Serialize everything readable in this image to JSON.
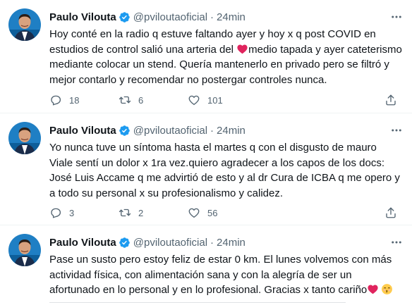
{
  "tweets": [
    {
      "name": "Paulo Vilouta",
      "handle": "@pviloutaoficial",
      "separator": "·",
      "time": "24min",
      "text_before_emoji": "Hoy conté en la radio q estuve faltando ayer y hoy x q post COVID en estudios de control salió una arteria del ",
      "emoji": "red-heart",
      "text_after_emoji": "medio tapada y ayer cateterismo mediante colocar un stend. Quería mantenerlo en privado pero se filtró y mejor contarlo y recomendar no postergar controles nunca.",
      "replies": "18",
      "retweets": "6",
      "likes": "101"
    },
    {
      "name": "Paulo Vilouta",
      "handle": "@pviloutaoficial",
      "separator": "·",
      "time": "24min",
      "text": "Yo nunca tuve un síntoma hasta el martes q con el disgusto de mauro Viale sentí un dolor x 1ra vez.quiero agradecer a los capos de los docs: José Luis Accame q me advirtió de esto y al dr Cura de ICBA q me opero y a todo su personal x su profesionalismo y calidez.",
      "replies": "3",
      "retweets": "2",
      "likes": "56"
    },
    {
      "name": "Paulo Vilouta",
      "handle": "@pviloutaoficial",
      "separator": "·",
      "time": "24min",
      "text": "Pase un susto pero estoy feliz de estar 0 km. El lunes volvemos con más actividad física, con alimentación sana y con la alegría de ser un afortunado en lo personal y en lo profesional. Gracias x tanto cariño",
      "emojis": [
        "red-heart",
        "kissing-face-with-smiling-eyes"
      ]
    }
  ],
  "colors": {
    "text": "#0f1419",
    "secondary": "#536471",
    "verified": "#1d9bf0",
    "heart": "#e0245e",
    "separator": "#eff3f4"
  }
}
